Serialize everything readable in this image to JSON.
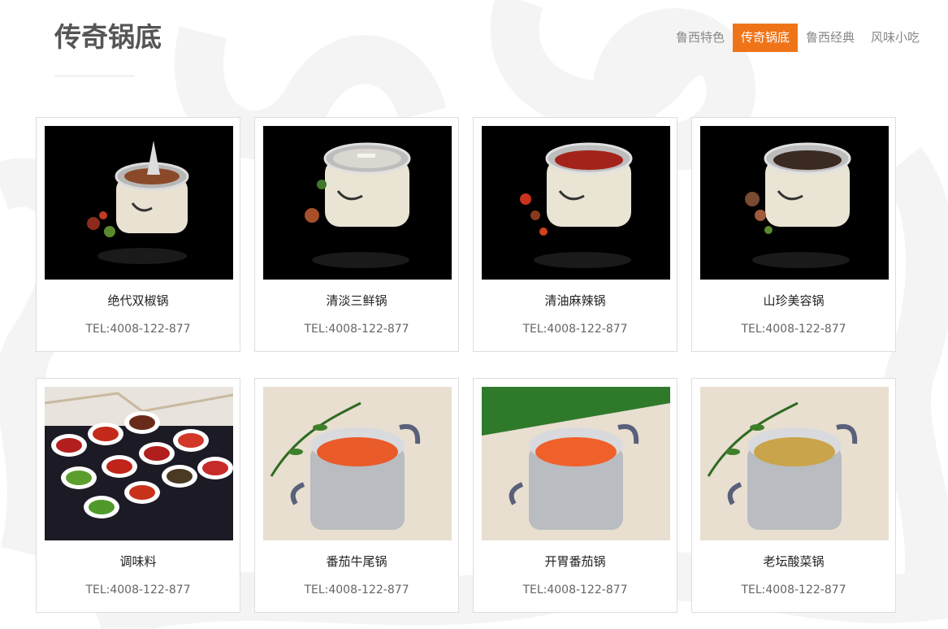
{
  "page": {
    "title": "传奇锅底"
  },
  "tabs": [
    {
      "label": "鲁西特色",
      "active": false
    },
    {
      "label": "传奇锅底",
      "active": true
    },
    {
      "label": "鲁西经典",
      "active": false
    },
    {
      "label": "风味小吃",
      "active": false
    }
  ],
  "colors": {
    "accent": "#ef7418",
    "title": "#555555",
    "card_border": "#dddddd"
  },
  "products": [
    {
      "name": "绝代双椒锅",
      "tel": "TEL:4008-122-877"
    },
    {
      "name": "清淡三鲜锅",
      "tel": "TEL:4008-122-877"
    },
    {
      "name": "清油麻辣锅",
      "tel": "TEL:4008-122-877"
    },
    {
      "name": "山珍美容锅",
      "tel": "TEL:4008-122-877"
    },
    {
      "name": "调味料",
      "tel": "TEL:4008-122-877"
    },
    {
      "name": "番茄牛尾锅",
      "tel": "TEL:4008-122-877"
    },
    {
      "name": "开胃番茄锅",
      "tel": "TEL:4008-122-877"
    },
    {
      "name": "老坛酸菜锅",
      "tel": "TEL:4008-122-877"
    }
  ]
}
